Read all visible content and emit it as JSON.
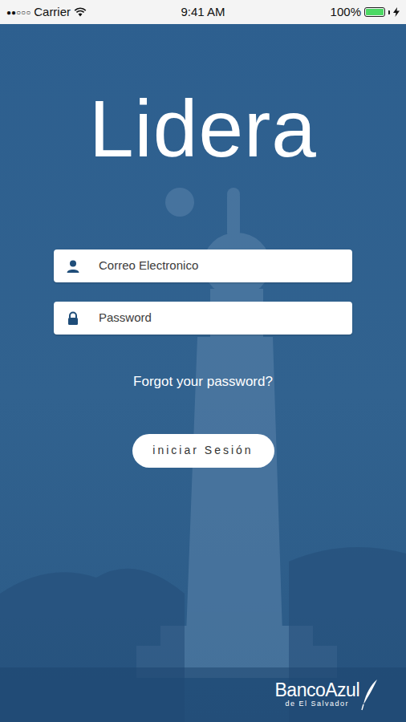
{
  "status_bar": {
    "signal": "●●○○○",
    "carrier": "Carrier",
    "time": "9:41 AM",
    "battery": "100%",
    "battery_level": 1.0
  },
  "title": "Lidera",
  "form": {
    "fields": [
      {
        "kind": "email",
        "placeholder": "Correo Electronico"
      },
      {
        "kind": "password",
        "placeholder": "Password"
      }
    ],
    "forgot_link": "Forgot your password?",
    "submit": "iniciar Sesión"
  },
  "footer": {
    "brand": "BancoAzul",
    "tagline": "de El Salvador"
  }
}
